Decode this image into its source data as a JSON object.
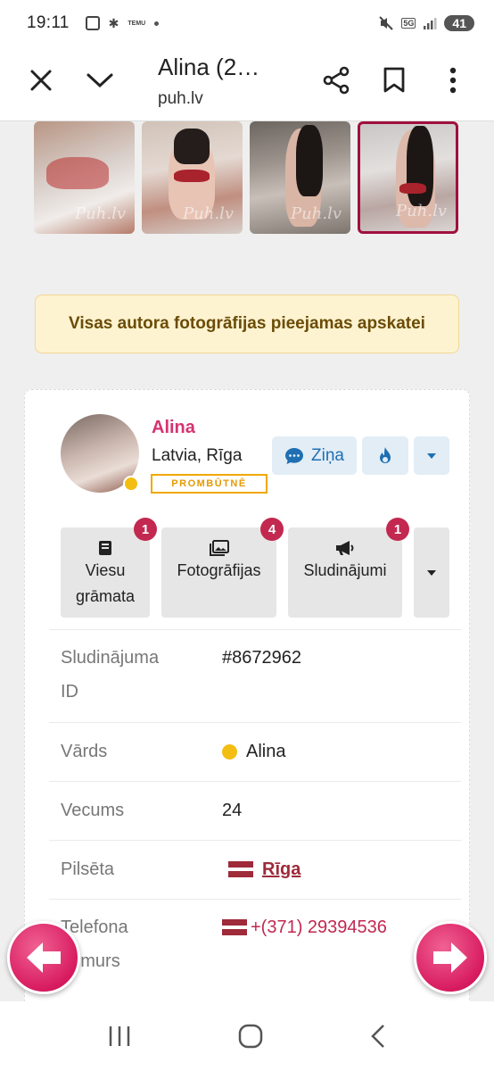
{
  "status_bar": {
    "time": "19:11",
    "temu_label": "TEMU",
    "network": "5G",
    "battery": "41"
  },
  "app_bar": {
    "title": "Alina (2…",
    "url": "puh.lv"
  },
  "gallery": {
    "watermark": "Puh.lv",
    "thumbnails": [
      "photo-1",
      "photo-2",
      "photo-3",
      "photo-4"
    ]
  },
  "notice": "Visas autora fotogrāfijas pieejamas apskatei",
  "profile": {
    "name": "Alina",
    "location": "Latvia, Rīga",
    "status": "PROMBŪTNĒ",
    "message_button": "Ziņa"
  },
  "nav_buttons": [
    {
      "label_line1": "Viesu",
      "label_line2": "grāmata",
      "badge": "1",
      "icon": "book-icon"
    },
    {
      "label_line1": "Fotogrāfijas",
      "label_line2": "",
      "badge": "4",
      "icon": "photos-icon"
    },
    {
      "label_line1": "Sludinājumi",
      "label_line2": "",
      "badge": "1",
      "icon": "megaphone-icon"
    }
  ],
  "details": [
    {
      "label_line1": "Sludinājuma",
      "label_line2": "ID",
      "value": "#8672962"
    },
    {
      "label_line1": "Vārds",
      "label_line2": "",
      "value": "Alina"
    },
    {
      "label_line1": "Vecums",
      "label_line2": "",
      "value": "24"
    },
    {
      "label_line1": "Pilsēta",
      "label_line2": "",
      "value": "Rīga"
    },
    {
      "label_line1": "Telefona",
      "label_line2": "numurs",
      "value": "+(371) 29394536"
    }
  ],
  "colors": {
    "accent_pink": "#d4336f",
    "badge_red": "#c22850",
    "notice_bg": "#fdf3d1",
    "status_orange": "#f0a800"
  }
}
